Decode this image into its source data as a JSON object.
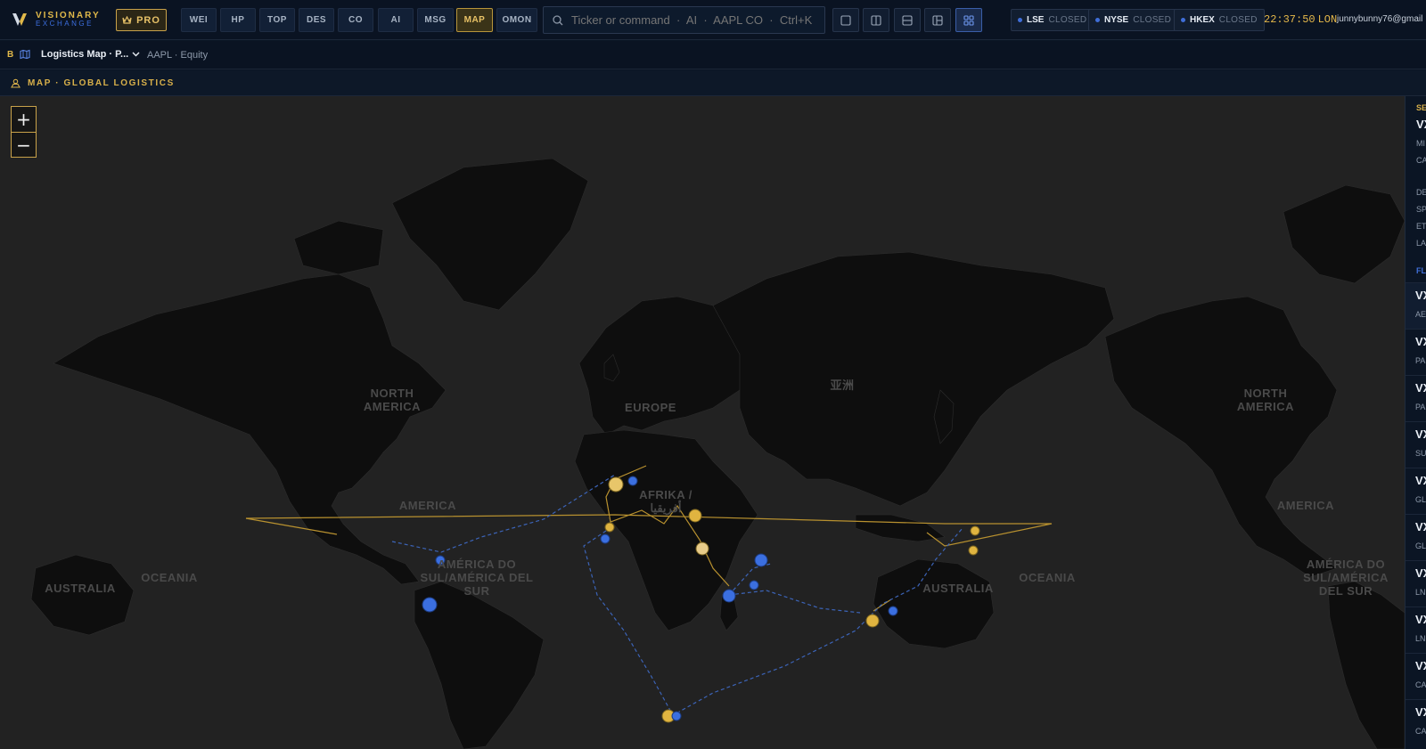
{
  "brand": {
    "name": "VISIONARY",
    "sub": "EXCHANGE",
    "pro_label": "PRO"
  },
  "functions": [
    {
      "label": "WEI",
      "active": false
    },
    {
      "label": "HP",
      "active": false
    },
    {
      "label": "TOP",
      "active": false
    },
    {
      "label": "DES",
      "active": false
    },
    {
      "label": "CO",
      "active": false
    },
    {
      "label": "AI",
      "active": false
    },
    {
      "label": "MSG",
      "active": false
    },
    {
      "label": "MAP",
      "active": true
    },
    {
      "label": "OMON",
      "active": false
    }
  ],
  "search": {
    "placeholder": "Ticker or command  ·  AI  ·  AAPL CO  ·  Ctrl+K"
  },
  "layouts": [
    "single-pane-icon",
    "split-vertical-icon",
    "split-horizontal-icon",
    "sidebar-layout-icon",
    "grid-layout-icon"
  ],
  "markets": [
    {
      "code": "LSE",
      "status": "CLOSED"
    },
    {
      "code": "NYSE",
      "status": "CLOSED"
    },
    {
      "code": "HKEX",
      "status": "CLOSED"
    }
  ],
  "clock": {
    "time": "22:37:50",
    "tz": "LON"
  },
  "user": {
    "email": "junnybunny76@gmail"
  },
  "window": {
    "badge": "B",
    "title": "Logistics Map · P...",
    "security": "AAPL · Equity"
  },
  "panel": {
    "title": "MAP · GLOBAL LOGISTICS"
  },
  "map": {
    "zoom_in": "+",
    "zoom_out": "−",
    "regions": [
      "NORTH AMERICA",
      "EUROPE",
      "亚洲",
      "AFRIKA / أفريقيا",
      "AMERICA",
      "AMÉRICA DO SUL/AMÉRICA DEL SUR",
      "AUSTRALIA",
      "OCEANIA",
      "NORTH AMERICA",
      "AMERICA",
      "AMÉRICA DO SUL/AMÉRICA DEL SUR",
      "AUSTRALIA",
      "OCEANIA"
    ],
    "colors": {
      "land": "#0e0e0e",
      "sea": "#222222",
      "port": "#e0b440",
      "vessel": "#3b6fe0"
    }
  },
  "side": {
    "header": "SE",
    "item": "VX",
    "meta": [
      "MI",
      "CA"
    ],
    "fields": [
      "DE",
      "SP",
      "ET",
      "LA"
    ],
    "flights_label": "FL",
    "rows": [
      {
        "code": "VX",
        "route": "AE"
      },
      {
        "code": "VX",
        "route": "PA"
      },
      {
        "code": "VX",
        "route": "PA"
      },
      {
        "code": "VX",
        "route": "SU"
      },
      {
        "code": "VX",
        "route": "GL"
      },
      {
        "code": "VX",
        "route": "GL"
      },
      {
        "code": "VX",
        "route": "LN"
      },
      {
        "code": "VX",
        "route": "LN"
      },
      {
        "code": "VX",
        "route": "CA"
      },
      {
        "code": "VX",
        "route": "CA"
      }
    ]
  }
}
